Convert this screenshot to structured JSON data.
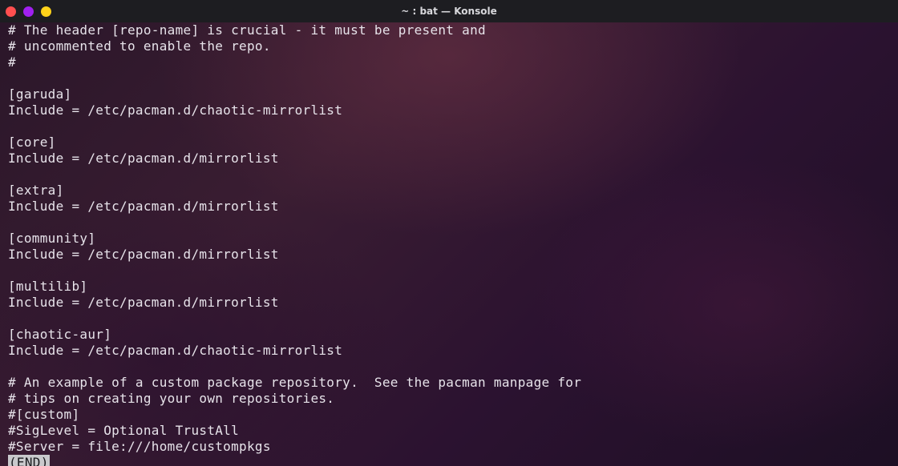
{
  "window": {
    "title": "~ : bat — Konsole"
  },
  "colors": {
    "close": "#ff4f4f",
    "minimize": "#a020f0",
    "maximize": "#ffd21a",
    "text": "#e7e3ea"
  },
  "terminal": {
    "lines": [
      "# The header [repo-name] is crucial - it must be present and",
      "# uncommented to enable the repo.",
      "#",
      "",
      "[garuda]",
      "Include = /etc/pacman.d/chaotic-mirrorlist",
      "",
      "[core]",
      "Include = /etc/pacman.d/mirrorlist",
      "",
      "[extra]",
      "Include = /etc/pacman.d/mirrorlist",
      "",
      "[community]",
      "Include = /etc/pacman.d/mirrorlist",
      "",
      "[multilib]",
      "Include = /etc/pacman.d/mirrorlist",
      "",
      "[chaotic-aur]",
      "Include = /etc/pacman.d/chaotic-mirrorlist",
      "",
      "# An example of a custom package repository.  See the pacman manpage for",
      "# tips on creating your own repositories.",
      "#[custom]",
      "#SigLevel = Optional TrustAll",
      "#Server = file:///home/custompkgs"
    ],
    "end_marker": "(END)"
  }
}
